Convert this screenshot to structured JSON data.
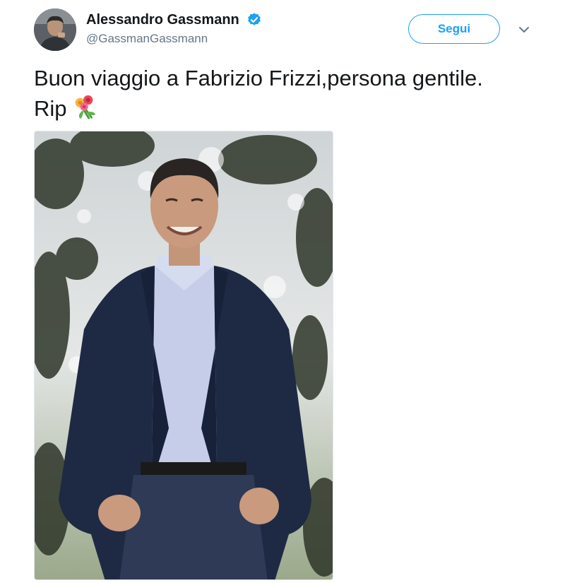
{
  "author": {
    "display_name": "Alessandro Gassmann",
    "handle": "@GassmanGassmann",
    "verified": true,
    "avatar_icon": "avatar-photo-icon",
    "verified_icon": "verified-badge-icon"
  },
  "follow_button": {
    "label": "Segui"
  },
  "menu": {
    "icon": "chevron-down-icon"
  },
  "tweet": {
    "text": "Buon viaggio a Fabrizio Frizzi,persona gentile. Rip",
    "emoji_icon": "bouquet-icon"
  },
  "media": {
    "type": "photo"
  },
  "colors": {
    "accent": "#1da1f2",
    "text": "#14171a",
    "secondary_text": "#657786"
  }
}
